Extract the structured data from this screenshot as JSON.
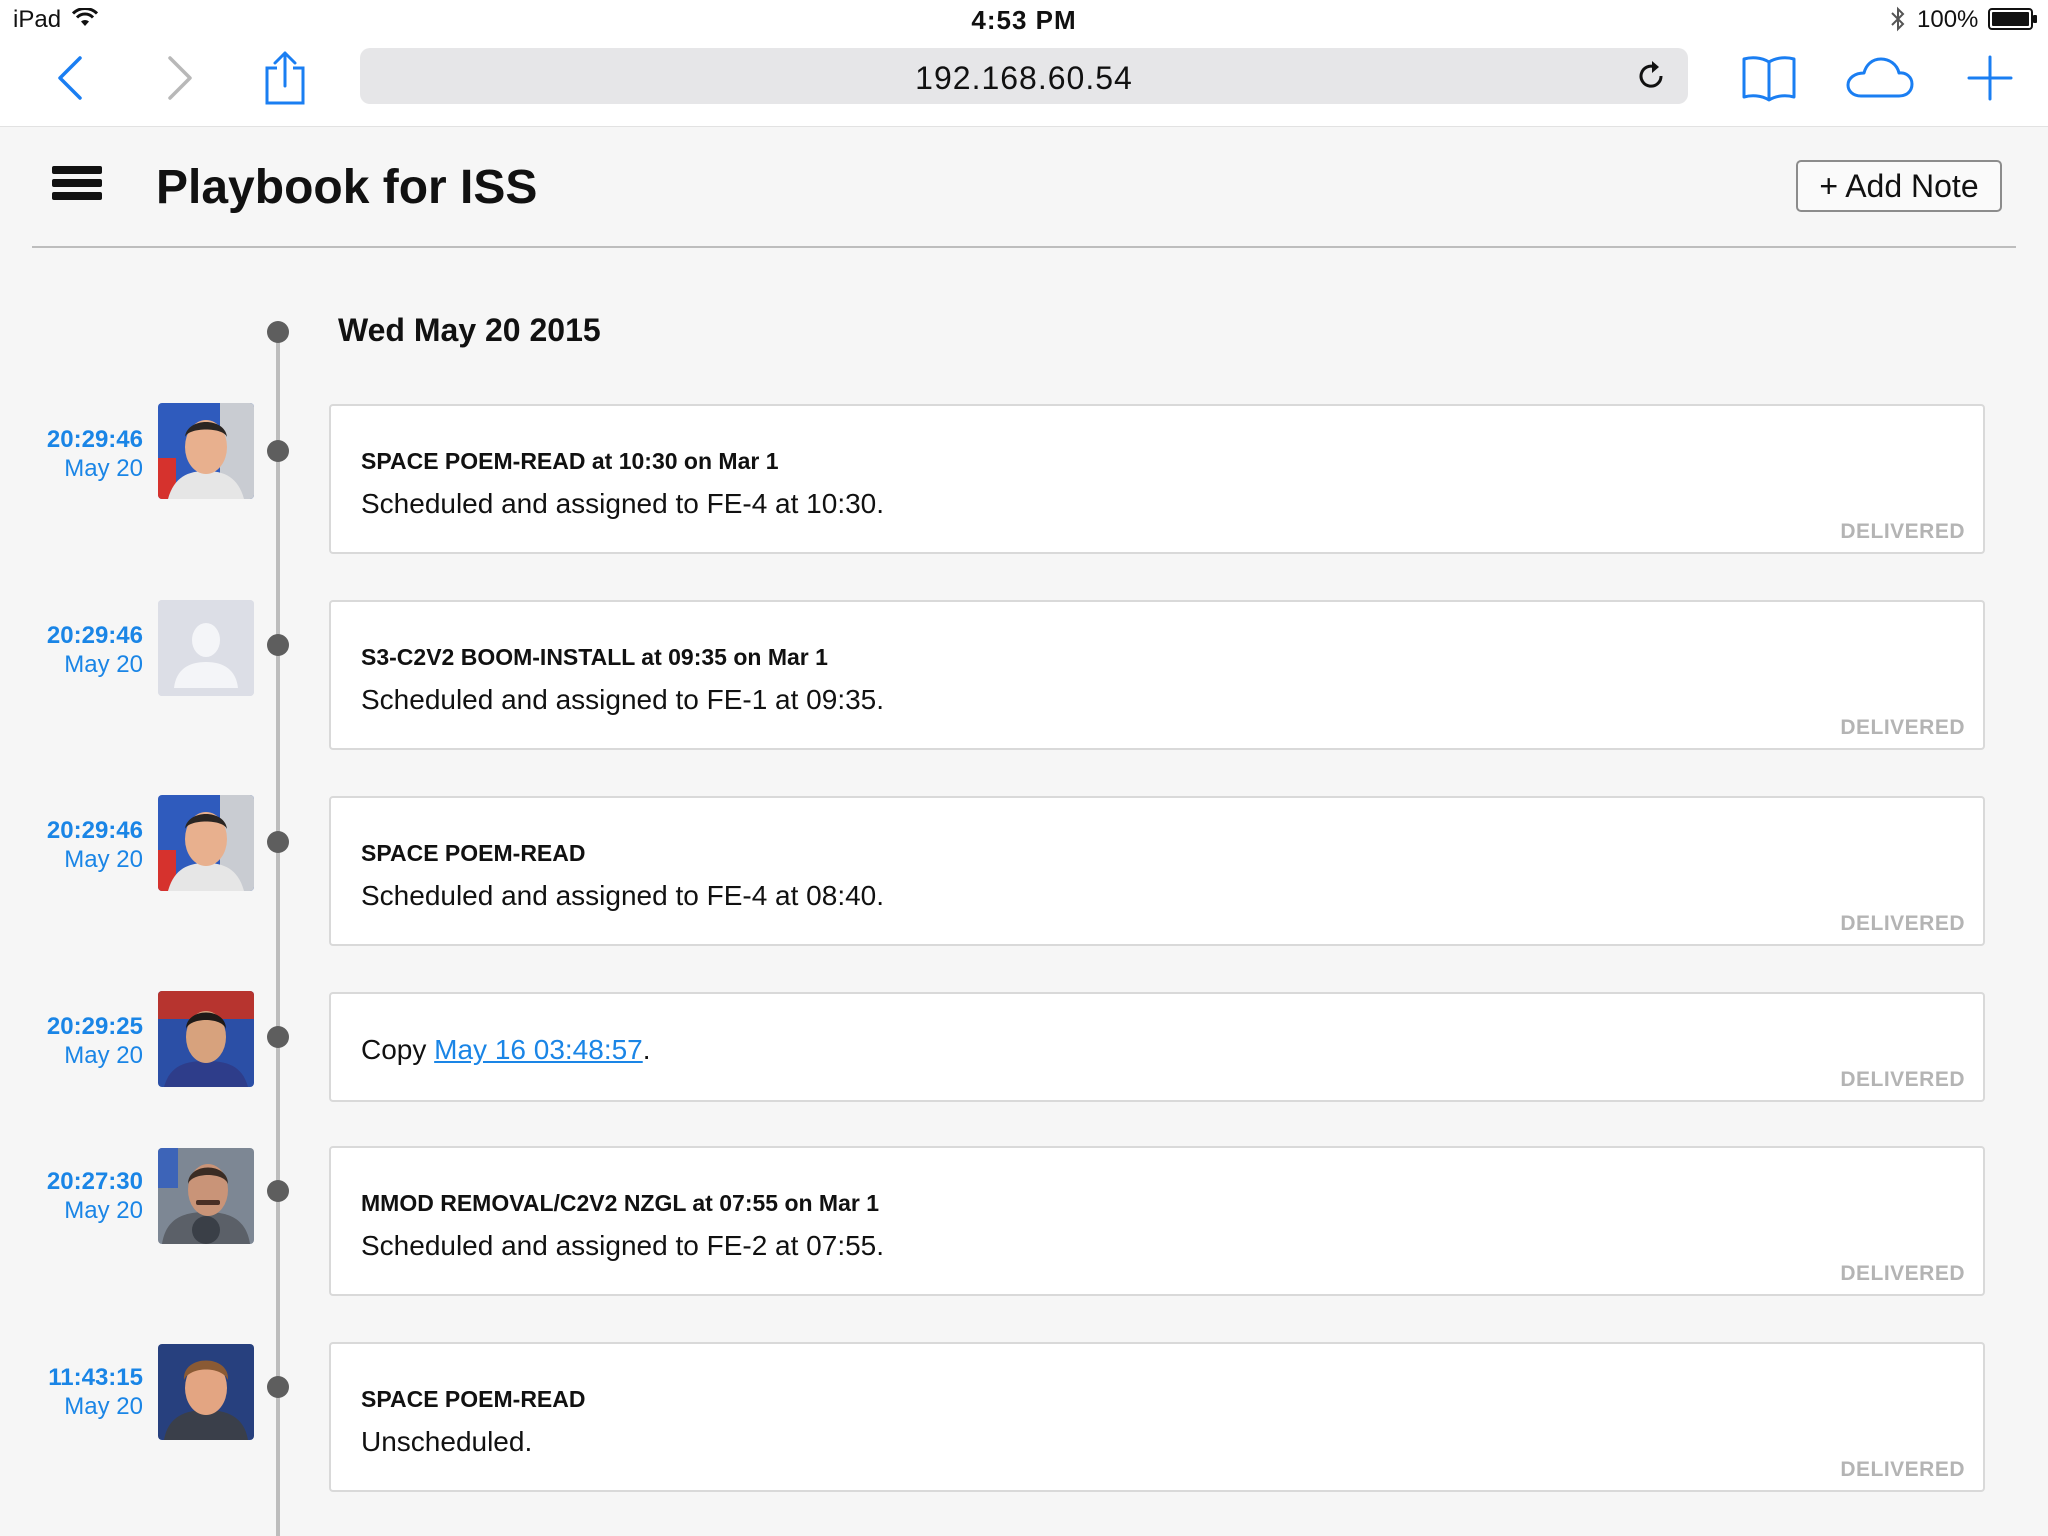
{
  "status_bar": {
    "device": "iPad",
    "time": "4:53 PM",
    "battery": "100%"
  },
  "browser": {
    "url": "192.168.60.54"
  },
  "header": {
    "title": "Playbook for ISS",
    "add_note_label": "+ Add Note"
  },
  "timeline": {
    "date_heading": "Wed May 20 2015",
    "entries": [
      {
        "time": "20:29:46",
        "day": "May 20",
        "avatar": "astronaut-photo",
        "title": "SPACE POEM-READ at 10:30 on Mar 1",
        "body": "Scheduled and assigned to FE-4 at 10:30.",
        "status": "DELIVERED"
      },
      {
        "time": "20:29:46",
        "day": "May 20",
        "avatar": "placeholder-person",
        "title": "S3-C2V2 BOOM-INSTALL at 09:35 on Mar 1",
        "body": "Scheduled and assigned to FE-1 at 09:35.",
        "status": "DELIVERED"
      },
      {
        "time": "20:29:46",
        "day": "May 20",
        "avatar": "astronaut-photo",
        "title": "SPACE POEM-READ",
        "body": "Scheduled and assigned to FE-4 at 08:40.",
        "status": "DELIVERED"
      },
      {
        "time": "20:29:25",
        "day": "May 20",
        "avatar": "astronaut-photo",
        "body_prefix": "Copy ",
        "body_link": "May 16 03:48:57",
        "body_suffix": ".",
        "status": "DELIVERED"
      },
      {
        "time": "20:27:30",
        "day": "May 20",
        "avatar": "astronaut-photo",
        "title": "MMOD REMOVAL/C2V2 NZGL at 07:55 on Mar 1",
        "body": "Scheduled and assigned to FE-2 at 07:55.",
        "status": "DELIVERED"
      },
      {
        "time": "11:43:15",
        "day": "May 20",
        "avatar": "astronaut-photo",
        "title": "SPACE POEM-READ",
        "body": "Unscheduled.",
        "status": "DELIVERED"
      }
    ]
  },
  "colors": {
    "link": "#1a85e6",
    "ios_blue": "#1a7ef2",
    "status_text": "#b4b4b4"
  }
}
